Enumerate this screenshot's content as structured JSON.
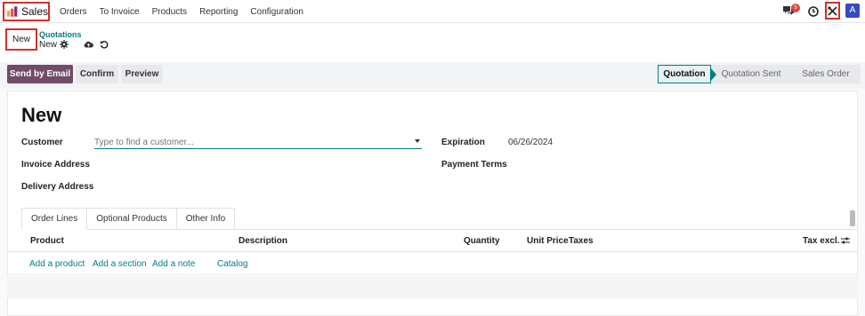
{
  "app": {
    "name": "Sales"
  },
  "menu": [
    "Orders",
    "To Invoice",
    "Products",
    "Reporting",
    "Configuration"
  ],
  "navbar": {
    "chat_badge": "5",
    "avatar_letter": "A"
  },
  "control": {
    "new_label": "New",
    "breadcrumb": "Quotations",
    "record_name": "New"
  },
  "actions": {
    "send_email": "Send by Email",
    "confirm": "Confirm",
    "preview": "Preview"
  },
  "status": {
    "stages": [
      "Quotation",
      "Quotation Sent",
      "Sales Order"
    ],
    "active": "Quotation"
  },
  "form": {
    "title": "New",
    "customer_label": "Customer",
    "customer_placeholder": "Type to find a customer...",
    "invoice_address_label": "Invoice Address",
    "delivery_address_label": "Delivery Address",
    "expiration_label": "Expiration",
    "expiration_value": "06/26/2024",
    "payment_terms_label": "Payment Terms"
  },
  "tabs": [
    "Order Lines",
    "Optional Products",
    "Other Info"
  ],
  "table": {
    "columns": [
      "Product",
      "Description",
      "Quantity",
      "Unit Price",
      "Taxes",
      "Tax excl."
    ]
  },
  "add_links": {
    "product": "Add a product",
    "section": "Add a section",
    "note": "Add a note",
    "catalog": "Catalog"
  },
  "colors": {
    "primary": "#714b67",
    "accent": "#017e84",
    "highlight": "#d32f2f",
    "avatar": "#3949c4"
  }
}
